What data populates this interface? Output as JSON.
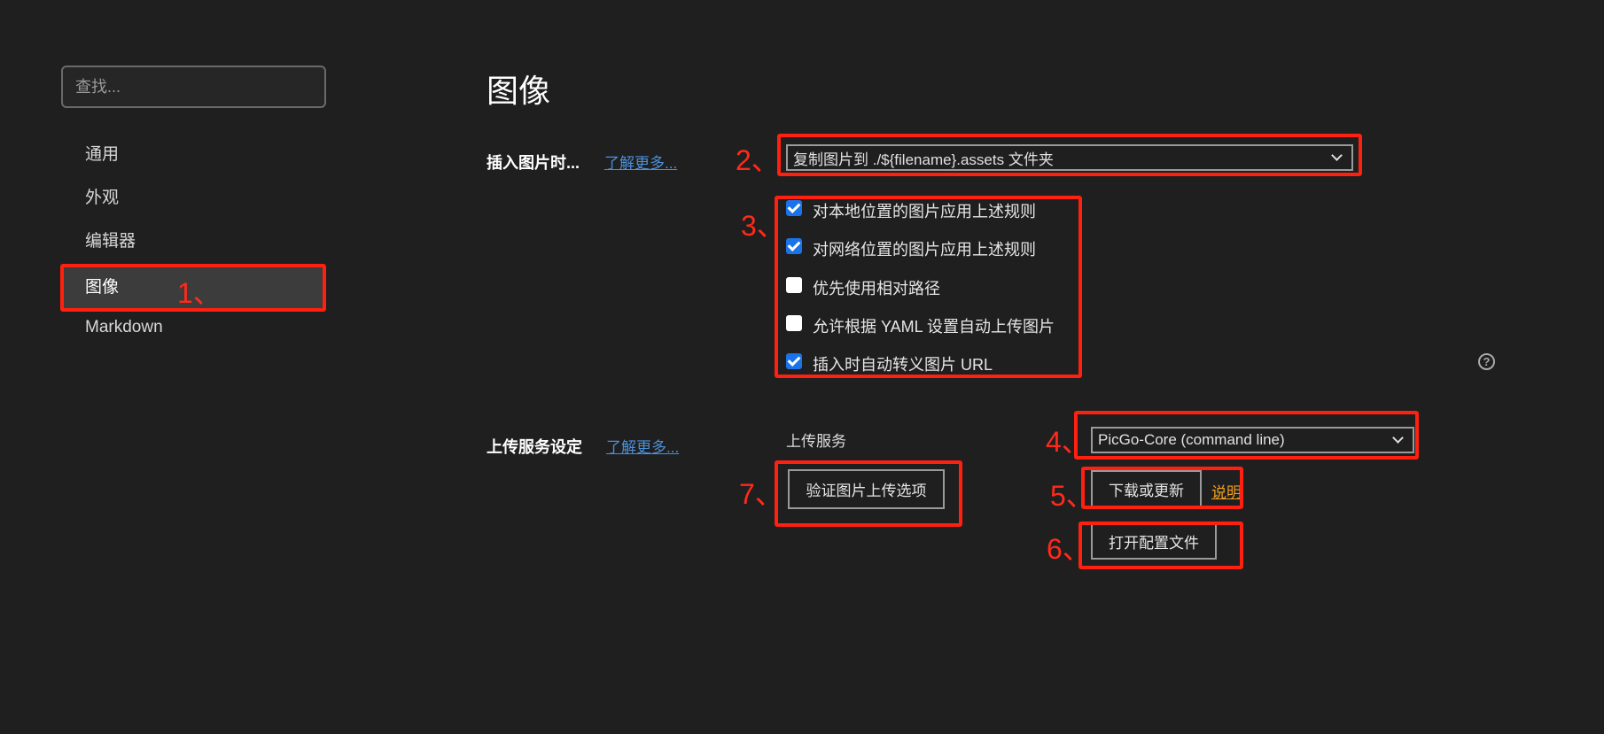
{
  "search": {
    "placeholder": "查找..."
  },
  "sidebar": {
    "items": [
      {
        "label": "通用"
      },
      {
        "label": "外观"
      },
      {
        "label": "编辑器"
      },
      {
        "label": "图像",
        "active": true
      },
      {
        "label": "Markdown"
      }
    ]
  },
  "page": {
    "title": "图像"
  },
  "insert": {
    "label": "插入图片时...",
    "learn_more": "了解更多...",
    "select_value": "复制图片到 ./${filename}.assets 文件夹",
    "options": [
      {
        "label": "对本地位置的图片应用上述规则",
        "checked": true
      },
      {
        "label": "对网络位置的图片应用上述规则",
        "checked": true
      },
      {
        "label": "优先使用相对路径",
        "checked": false
      },
      {
        "label": "允许根据 YAML 设置自动上传图片",
        "checked": false
      },
      {
        "label": "插入时自动转义图片 URL",
        "checked": true
      }
    ],
    "help_icon": "?"
  },
  "upload": {
    "label": "上传服务设定",
    "learn_more": "了解更多...",
    "service_label": "上传服务",
    "service_value": "PicGo-Core (command line)",
    "validate_button": "验证图片上传选项",
    "download_button": "下载或更新",
    "explain_link": "说明",
    "open_config_button": "打开配置文件"
  },
  "annotations": [
    "1、",
    "2、",
    "3、",
    "4、",
    "5、",
    "6、",
    "7、"
  ],
  "colors": {
    "background": "#1f1f1f",
    "annotation": "#ff2010",
    "checkbox": "#1a73e8",
    "link": "#4a90d9",
    "explain": "#f0a020"
  }
}
